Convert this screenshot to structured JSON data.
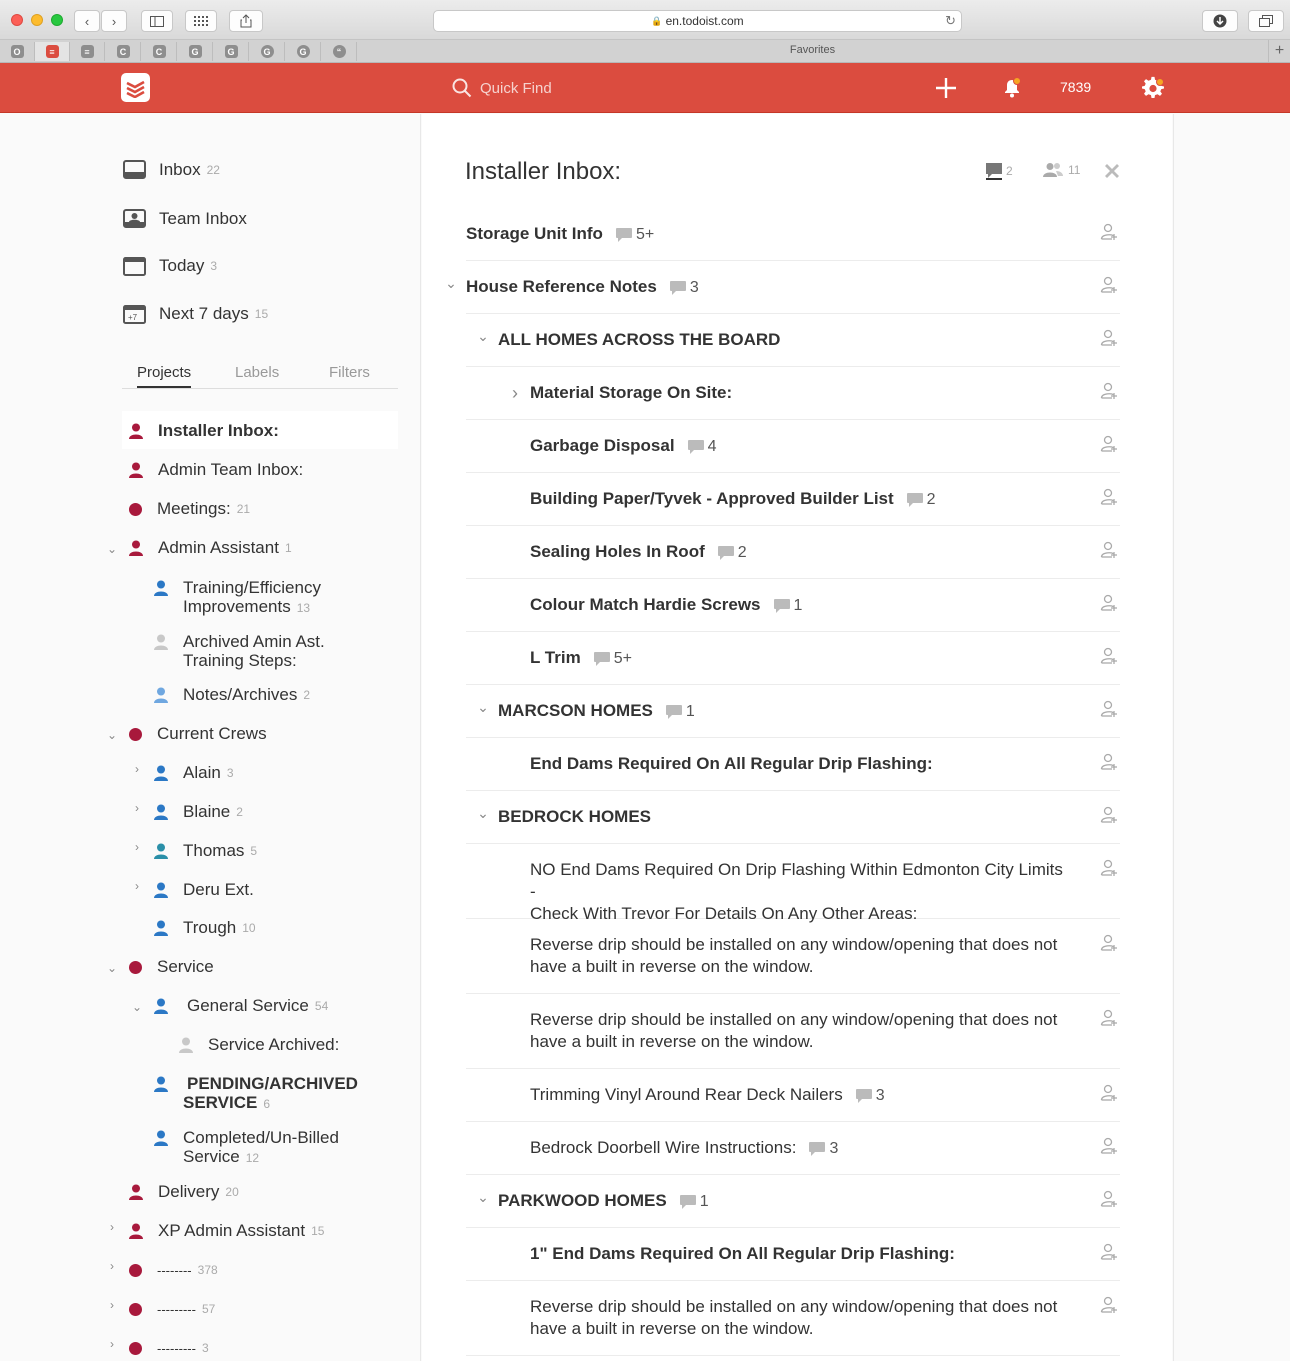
{
  "browser": {
    "url": "en.todoist.com",
    "favorites_label": "Favorites"
  },
  "header": {
    "search_placeholder": "Quick Find",
    "karma": "7839"
  },
  "nav": {
    "inbox": {
      "label": "Inbox",
      "count": "22"
    },
    "team_inbox": {
      "label": "Team Inbox"
    },
    "today": {
      "label": "Today",
      "count": "3"
    },
    "next7": {
      "label": "Next 7 days",
      "count": "15"
    },
    "next7_icon_text": "+7"
  },
  "tabs": {
    "projects": "Projects",
    "labels": "Labels",
    "filters": "Filters"
  },
  "projects": {
    "installer_inbox": {
      "label": "Installer Inbox:"
    },
    "admin_team_inbox": {
      "label": "Admin Team Inbox:"
    },
    "meetings": {
      "label": "Meetings:",
      "count": "21"
    },
    "admin_assistant": {
      "label": "Admin Assistant",
      "count": "1"
    },
    "training": {
      "line1": "Training/Efficiency",
      "line2": "Improvements",
      "count": "13"
    },
    "archived_amin": {
      "line1": "Archived Amin Ast.",
      "line2": "Training Steps:"
    },
    "notes_archives": {
      "label": "Notes/Archives",
      "count": "2"
    },
    "current_crews": {
      "label": "Current Crews"
    },
    "alain": {
      "label": "Alain",
      "count": "3"
    },
    "blaine": {
      "label": "Blaine",
      "count": "2"
    },
    "thomas": {
      "label": "Thomas",
      "count": "5"
    },
    "deru": {
      "label": "Deru Ext."
    },
    "trough": {
      "label": "Trough",
      "count": "10"
    },
    "service": {
      "label": "Service"
    },
    "general_service": {
      "label": "General Service",
      "count": "54"
    },
    "service_archived": {
      "label": "Service Archived:"
    },
    "pending": {
      "line1": "PENDING/ARCHIVED",
      "line2": "SERVICE",
      "count": "6"
    },
    "completed": {
      "line1": "Completed/Un-Billed",
      "line2": "Service",
      "count": "12"
    },
    "delivery": {
      "label": "Delivery",
      "count": "20"
    },
    "xp_admin": {
      "label": "XP Admin Assistant",
      "count": "15"
    },
    "dash1": {
      "label": "--------",
      "count": "378"
    },
    "dash2": {
      "label": "---------",
      "count": "57"
    },
    "dash3": {
      "label": "---------",
      "count": "3"
    }
  },
  "main": {
    "title": "Installer Inbox:",
    "comments_count": "2",
    "collaborators_count": "11",
    "tasks": [
      {
        "text": "Storage Unit Info",
        "comments": "5+"
      },
      {
        "text": "House Reference Notes",
        "comments": "3"
      },
      {
        "text": "ALL HOMES ACROSS THE BOARD"
      },
      {
        "text": "Material Storage On Site:"
      },
      {
        "text": "Garbage Disposal",
        "comments": "4"
      },
      {
        "text": "Building Paper/Tyvek - Approved Builder List",
        "comments": "2"
      },
      {
        "text": "Sealing Holes In Roof",
        "comments": "2"
      },
      {
        "text": "Colour Match Hardie Screws",
        "comments": "1"
      },
      {
        "text": "L Trim",
        "comments": "5+"
      },
      {
        "text": "MARCSON HOMES",
        "comments": "1"
      },
      {
        "text": "End Dams Required On All Regular Drip Flashing:"
      },
      {
        "text": "BEDROCK HOMES"
      },
      {
        "text": "NO End Dams Required On Drip Flashing Within Edmonton City Limits -",
        "text2": "Check With Trevor For Details On Any Other Areas:"
      },
      {
        "text": "Reverse drip should be installed on any window/opening that does not",
        "text2": "have a built in reverse on the window."
      },
      {
        "text": "Reverse drip should be installed on any window/opening that does not",
        "text2": "have a built in reverse on the window."
      },
      {
        "text": "Trimming Vinyl Around Rear Deck Nailers",
        "comments": "3"
      },
      {
        "text": "Bedrock Doorbell Wire Instructions:",
        "comments": "3"
      },
      {
        "text": "PARKWOOD HOMES",
        "comments": "1"
      },
      {
        "text": "1\" End Dams Required On All Regular Drip Flashing:"
      },
      {
        "text": "Reverse drip should be installed on any window/opening that does not",
        "text2": "have a built in reverse on the window."
      }
    ]
  },
  "colors": {
    "brand": "#db4c3f",
    "project_red": "#a8193c",
    "person_blue": "#2b78c5",
    "person_light": "#6fa7e0",
    "person_teal": "#2a8fa8",
    "person_grey": "#c8c8c8"
  },
  "icons": [
    "search-icon",
    "plus-icon",
    "bell-icon",
    "gear-icon",
    "inbox-icon",
    "team-inbox-icon",
    "calendar-icon",
    "comment-icon",
    "person-icon",
    "assign-icon"
  ]
}
